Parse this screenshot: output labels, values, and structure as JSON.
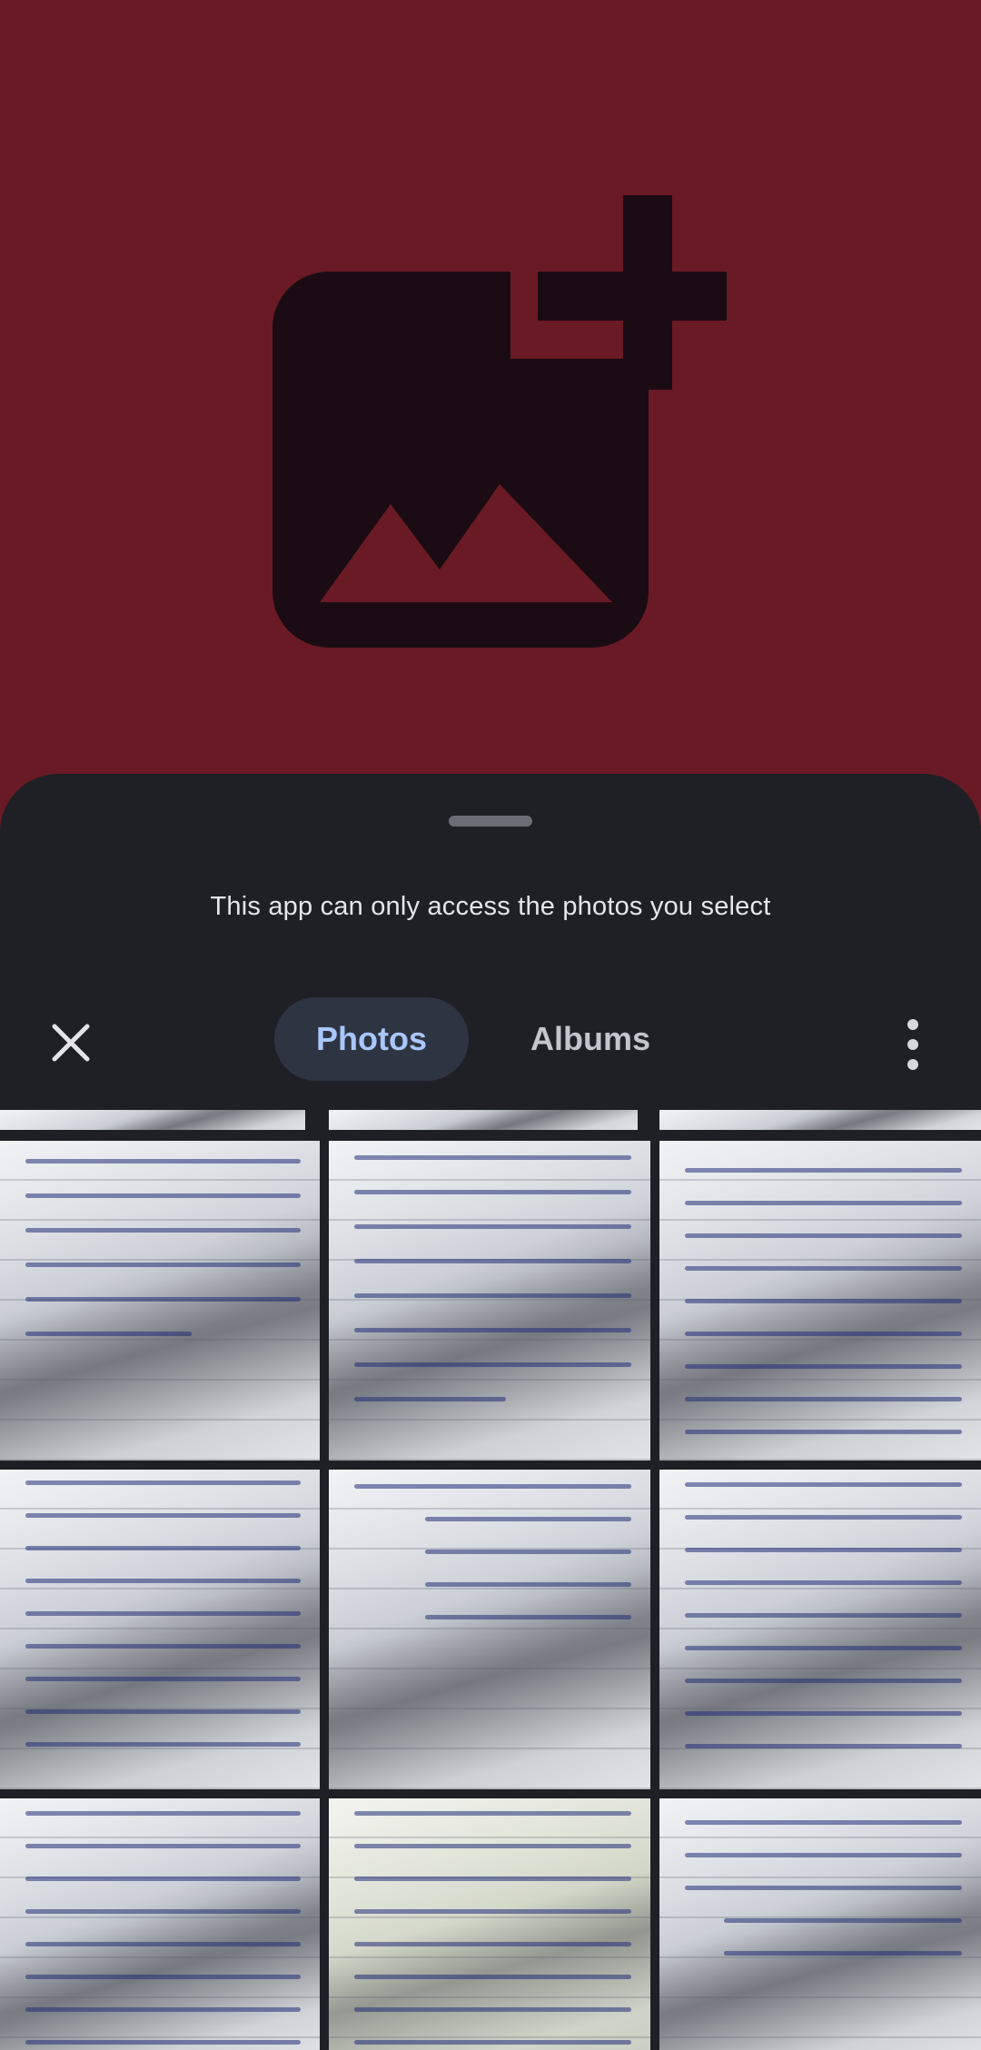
{
  "picker": {
    "message": "This app can only access the photos you select",
    "close_label": "close",
    "tabs": [
      {
        "label": "Photos",
        "active": true
      },
      {
        "label": "Albums",
        "active": false
      }
    ],
    "more_label": "more options"
  },
  "colors": {
    "hero_background": "#6a1a24",
    "hero_icon": "#1a0c12",
    "sheet_background": "#1e2026",
    "active_tab_background": "#2f3442",
    "active_tab_text": "#a9c7ff"
  },
  "icons": {
    "hero": "add-photo-icon",
    "close": "close-icon",
    "more": "more-vert-icon"
  },
  "photos": {
    "count_visible": 12,
    "items": [
      "handwritten-notes-photo-1",
      "handwritten-notes-photo-2",
      "handwritten-notes-photo-3",
      "handwritten-notes-photo-4",
      "handwritten-notes-photo-5",
      "handwritten-notes-photo-6",
      "handwritten-notes-photo-7",
      "handwritten-notes-photo-8",
      "handwritten-notes-photo-9",
      "handwritten-notes-photo-10",
      "handwritten-notes-photo-11",
      "handwritten-notes-photo-12"
    ]
  }
}
